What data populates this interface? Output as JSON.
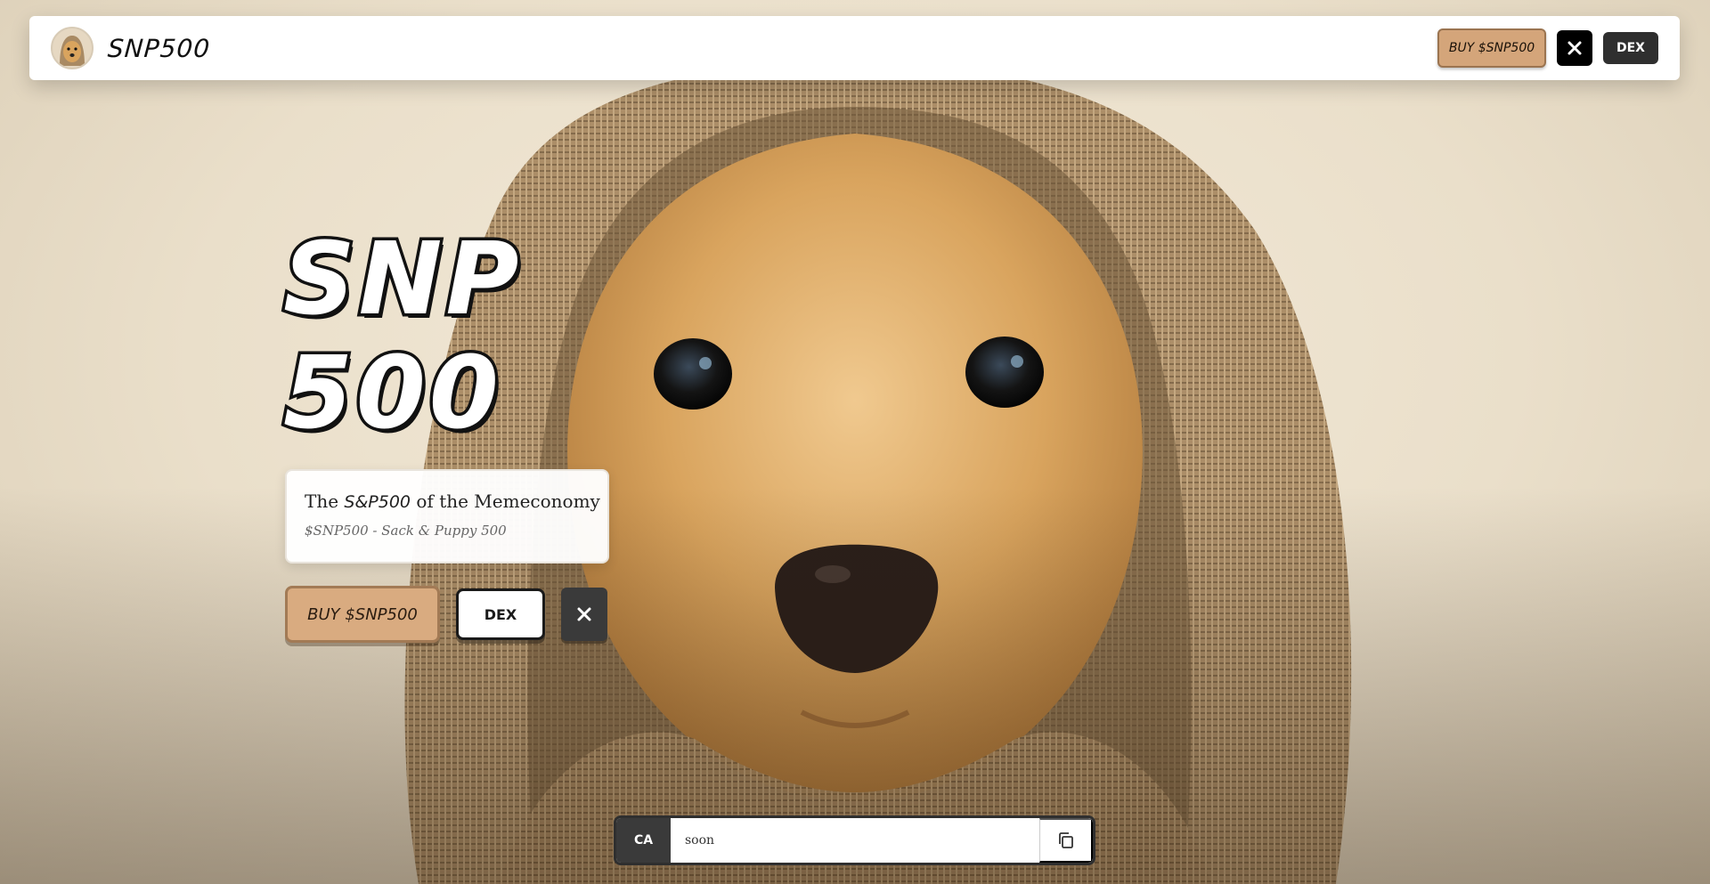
{
  "navbar": {
    "brand": "SNP500",
    "buy_label": "BUY $SNP500",
    "dex_label": "DEX",
    "x_icon": "x-twitter-icon"
  },
  "hero": {
    "title_line1": "SNP",
    "title_line2": "500",
    "tagline_prefix": "The",
    "tagline_brand": "S&P500",
    "tagline_suffix": "of the Memeconomy",
    "subtitle": "$SNP500 - Sack & Puppy 500",
    "buy_label": "BUY $SNP500",
    "dex_label": "DEX"
  },
  "contract": {
    "label": "CA",
    "value": "soon",
    "copy_icon": "copy-icon"
  },
  "colors": {
    "accent": "#d4a57a",
    "dark": "#2f2f2f"
  }
}
